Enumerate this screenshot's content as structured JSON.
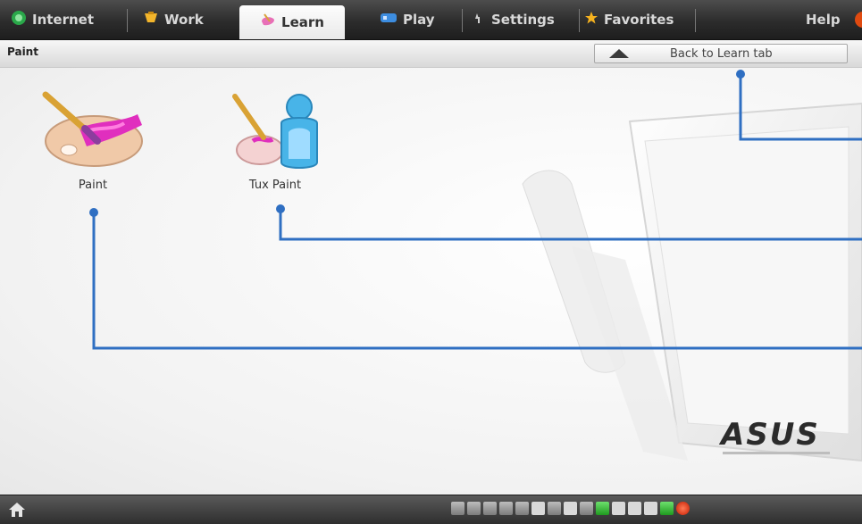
{
  "tabs": [
    {
      "label": "Internet",
      "icon": "internet-globe-icon"
    },
    {
      "label": "Work",
      "icon": "work-icon"
    },
    {
      "label": "Learn",
      "icon": "learn-icon",
      "active": true
    },
    {
      "label": "Play",
      "icon": "play-icon"
    },
    {
      "label": "Settings",
      "icon": "settings-icon"
    },
    {
      "label": "Favorites",
      "icon": "favorites-star-icon"
    }
  ],
  "help_label": "Help",
  "subbar": {
    "breadcrumb": "Paint",
    "back_label": "Back to Learn tab"
  },
  "apps": [
    {
      "label": "Paint",
      "icon": "paint-palette-icon"
    },
    {
      "label": "Tux Paint",
      "icon": "tux-paint-icon"
    }
  ],
  "brand": "ASUS",
  "colors": {
    "callout": "#2f6fc2",
    "accent_orange": "#e04a10"
  }
}
